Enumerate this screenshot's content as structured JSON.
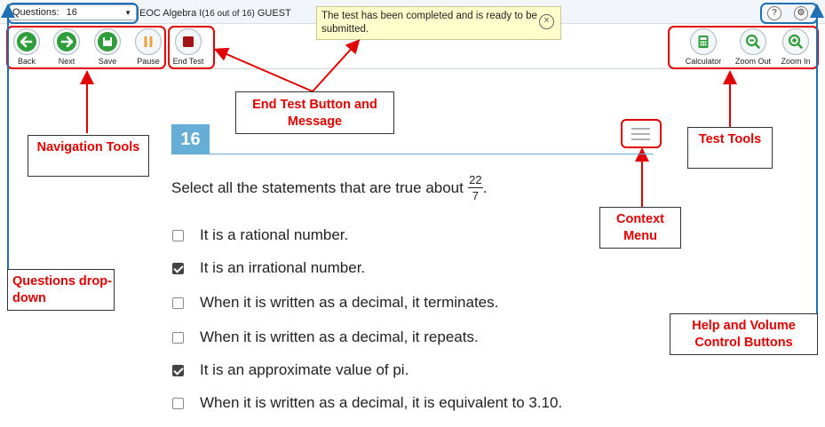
{
  "topbar": {
    "questions_label": "Questions:",
    "questions_value": "16",
    "exam_title": "EOC Algebra I",
    "exam_count": "(16 out of 16)",
    "user": "GUEST"
  },
  "message": "The test has been completed and is ready to be submitted.",
  "nav_buttons": [
    {
      "label": "Back",
      "icon": "arrow-left-icon",
      "color": "#2e9d3a"
    },
    {
      "label": "Next",
      "icon": "arrow-right-icon",
      "color": "#2e9d3a"
    },
    {
      "label": "Save",
      "icon": "floppy-disk-icon",
      "color": "#2e9d3a"
    },
    {
      "label": "Pause",
      "icon": "pause-icon",
      "color": "#e8a33a"
    }
  ],
  "end_test": {
    "label": "End Test",
    "icon": "stop-icon",
    "color": "#a31515"
  },
  "tool_buttons": [
    {
      "label": "Calculator",
      "icon": "calculator-icon",
      "color": "#2e9d3a"
    },
    {
      "label": "Zoom Out",
      "icon": "zoom-out-icon",
      "color": "#2e9d3a"
    },
    {
      "label": "Zoom In",
      "icon": "zoom-in-icon",
      "color": "#2e9d3a"
    }
  ],
  "help_volume": [
    {
      "label": "?",
      "icon": "help-icon"
    },
    {
      "label": "⚙",
      "icon": "gear-icon"
    }
  ],
  "callouts": {
    "navigation": "Navigation Tools",
    "end_test": "End Test Button and Message",
    "test_tools": "Test Tools",
    "context_menu": "Context Menu",
    "questions": "Questions drop-down",
    "help_volume": "Help and Volume Control Buttons"
  },
  "question": {
    "number": "16",
    "prompt": "Select all the statements that are true about",
    "fraction_num": "22",
    "fraction_den": "7",
    "prompt_end": ".",
    "options": [
      {
        "text": "It is a rational number.",
        "checked": false
      },
      {
        "text": "It is an irrational number.",
        "checked": true
      },
      {
        "text": "When it is written as a decimal, it terminates.",
        "checked": false
      },
      {
        "text": "When it is written as a decimal, it repeats.",
        "checked": false
      },
      {
        "text": "It is an approximate value of pi.",
        "checked": true
      },
      {
        "text": "When it is written as a decimal, it is equivalent to 3.10.",
        "checked": false
      }
    ]
  },
  "colors": {
    "annotation_red": "#e00000",
    "annotation_blue": "#1f6fb5",
    "question_blue": "#66aed6"
  }
}
